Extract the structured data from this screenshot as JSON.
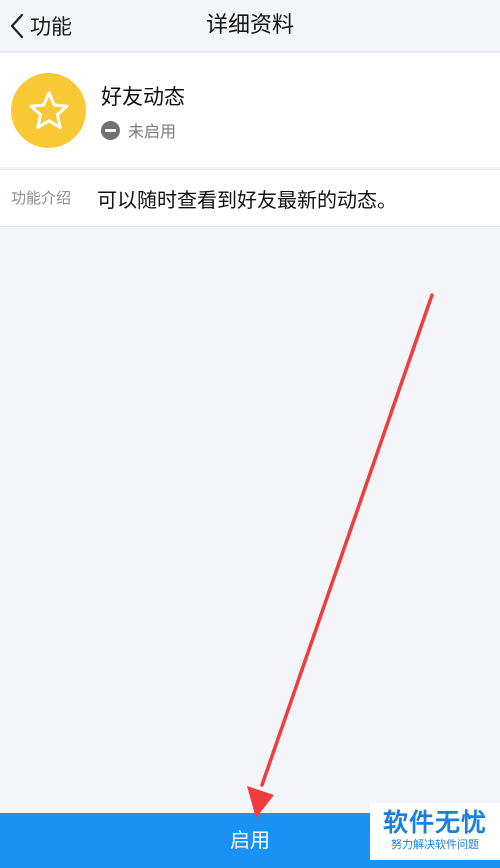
{
  "navbar": {
    "back_label": "功能",
    "title": "详细资料"
  },
  "feature": {
    "icon": "star-icon",
    "name": "好友动态",
    "status_icon": "minus-circle-icon",
    "status": "未启用"
  },
  "intro": {
    "label": "功能介绍",
    "text": "可以随时查看到好友最新的动态。"
  },
  "action": {
    "enable_label": "启用"
  },
  "watermark": {
    "main": "软件无忧",
    "sub": "努力解决软件问题"
  },
  "colors": {
    "accent": "#1a91f5",
    "icon_bg": "#f8c934",
    "annotation": "#f03c3c",
    "watermark": "#1a7fe0"
  }
}
